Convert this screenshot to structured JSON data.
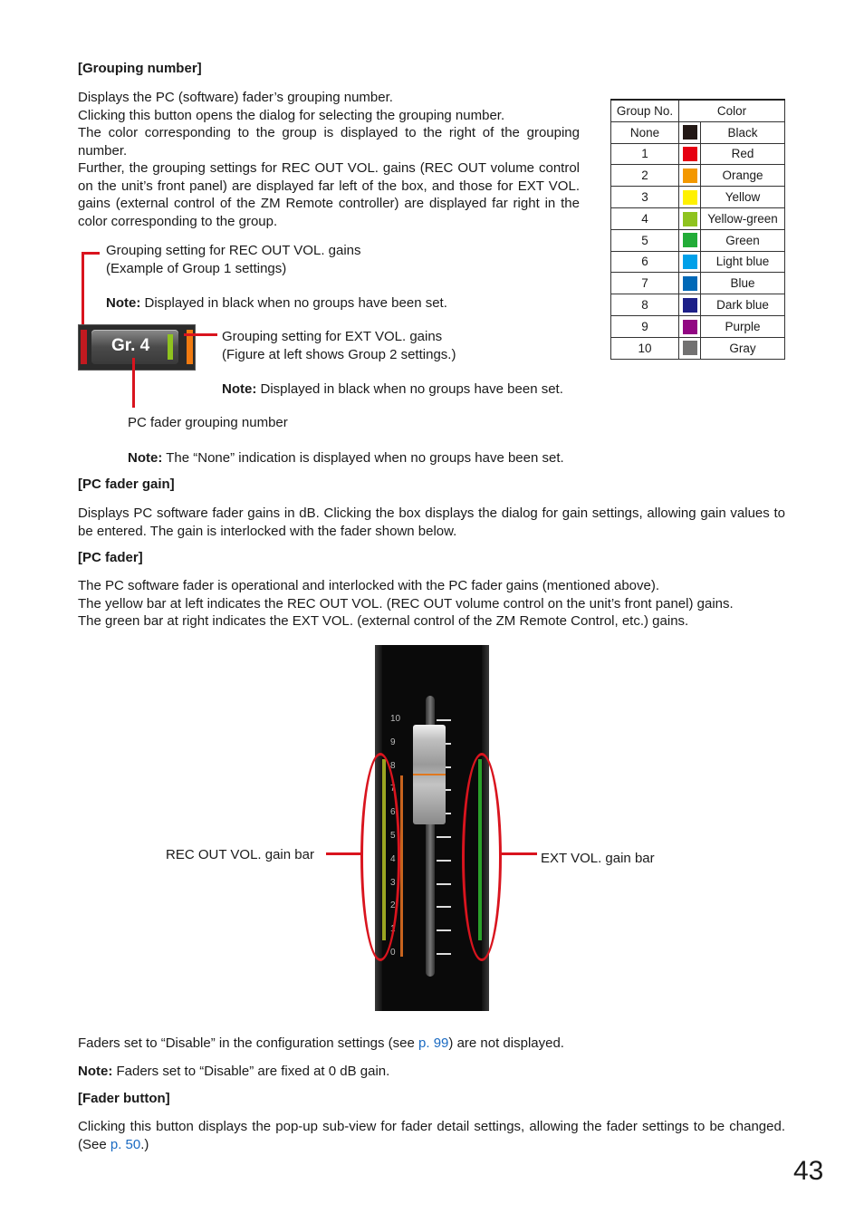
{
  "sections": {
    "grouping": {
      "heading": "[Grouping number]",
      "lines": [
        "Displays the PC (software) fader’s grouping number.",
        "Clicking this button opens the dialog for selecting the grouping number.",
        "The color corresponding to the group is displayed to the right of the grouping number.",
        "Further, the grouping settings for REC OUT VOL. gains (REC OUT volume control on the unit’s front panel) are displayed far left of the box, and those for EXT VOL. gains (external control of the ZM Remote controller) are displayed far right in the color corresponding to the group."
      ],
      "callout_rec": {
        "line1": "Grouping setting for REC OUT VOL. gains",
        "line2": "(Example of Group 1 settings)",
        "note_label": "Note:",
        "note_text": " Displayed in black when no groups have been set."
      },
      "callout_ext": {
        "line1": "Grouping setting for EXT VOL. gains",
        "line2": "(Figure at left shows Group 2 settings.)",
        "note_label": "Note:",
        "note_text": " Displayed in black when no groups have been set."
      },
      "callout_number": {
        "line1": "PC fader grouping number",
        "note_label": "Note:",
        "note_text": " The “None” indication is displayed when no groups have been set."
      },
      "button_label": "Gr. 4",
      "table": {
        "headers": [
          "Group No.",
          "Color"
        ],
        "rows": [
          {
            "no": "None",
            "color": "Black",
            "hex": "#231815"
          },
          {
            "no": "1",
            "color": "Red",
            "hex": "#e60012"
          },
          {
            "no": "2",
            "color": "Orange",
            "hex": "#f39800"
          },
          {
            "no": "3",
            "color": "Yellow",
            "hex": "#fff100"
          },
          {
            "no": "4",
            "color": "Yellow-green",
            "hex": "#8fc31f"
          },
          {
            "no": "5",
            "color": "Green",
            "hex": "#22ac38"
          },
          {
            "no": "6",
            "color": "Light blue",
            "hex": "#00a0e9"
          },
          {
            "no": "7",
            "color": "Blue",
            "hex": "#0068b7"
          },
          {
            "no": "8",
            "color": "Dark blue",
            "hex": "#1d2088"
          },
          {
            "no": "9",
            "color": "Purple",
            "hex": "#920783"
          },
          {
            "no": "10",
            "color": "Gray",
            "hex": "#727171"
          }
        ]
      }
    },
    "gain": {
      "heading": "[PC fader gain]",
      "text": "Displays PC software fader gains in dB. Clicking the box displays the dialog for gain settings, allowing gain values to be entered. The gain is interlocked with the fader shown below."
    },
    "fader": {
      "heading": "[PC fader]",
      "lines": [
        "The PC software fader is operational and interlocked with the PC fader gains (mentioned above).",
        "The yellow bar at left indicates the REC OUT VOL. (REC OUT volume control on the unit’s front panel) gains.",
        "The green bar at right indicates the EXT VOL. (external control of the ZM Remote Control, etc.) gains."
      ],
      "scale_labels": [
        "10",
        "9",
        "8",
        "7",
        "6",
        "5",
        "4",
        "3",
        "2",
        "1",
        "0"
      ],
      "label_rec": "REC OUT VOL. gain bar",
      "label_ext": "EXT VOL. gain bar",
      "disable_pre": "Faders set to “Disable” in the configuration settings (see ",
      "disable_link": "p. 99",
      "disable_post": ") are not displayed.",
      "note_label": "Note:",
      "note_text": " Faders set to “Disable” are fixed at 0 dB gain."
    },
    "button": {
      "heading": "[Fader button]",
      "pre": "Clicking this button displays the pop-up sub-view for fader detail settings, allowing the fader settings to be changed. (See ",
      "link": "p. 50",
      "post": ".)"
    }
  },
  "page_number": "43"
}
